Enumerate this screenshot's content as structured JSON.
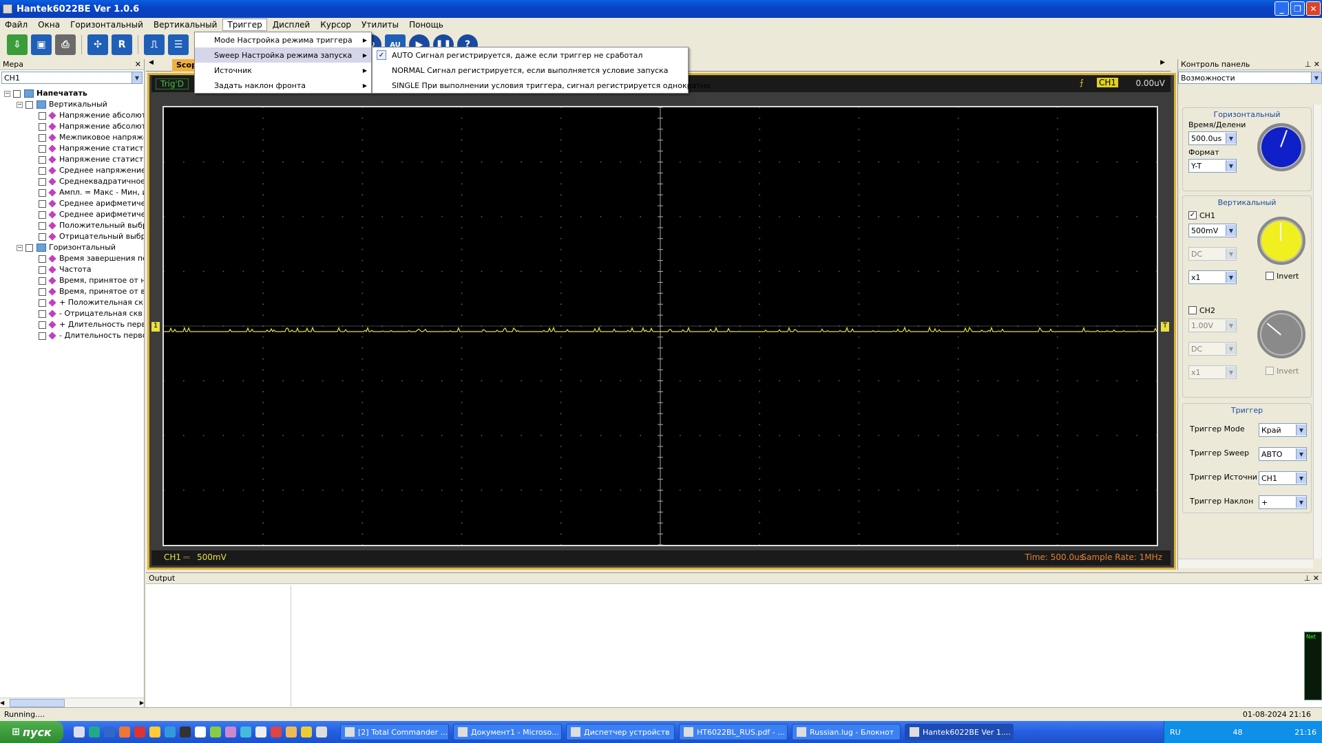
{
  "window": {
    "title": "Hantek6022BE Ver 1.0.6"
  },
  "menubar": [
    "Файл",
    "Окна",
    "Горизонтальный",
    "Вертикальный",
    "Триггер",
    "Дисплей",
    "Курсор",
    "Утилиты",
    "Понощь"
  ],
  "trigger_menu": {
    "items": [
      "Mode Настройка режима триггера",
      "Sweep Настройка режима запуска",
      "Источник",
      "Задать наклон фронта"
    ],
    "highlighted": 1
  },
  "sweep_submenu": {
    "items": [
      "AUTO Сигнал регистрируется, даже если триггер не сработал",
      "NORMAL Сигнал регистрируется, если выполняется условие запуска",
      "SINGLE При выполнении условия триггера, сигнал регистрируется однократно"
    ],
    "checked": 0
  },
  "toolbar": {
    "icons": [
      "open-icon",
      "save-icon",
      "print-icon",
      "autoset-icon",
      "reset-icon",
      "pulse-icon",
      "layout-icon"
    ],
    "r_label": "R",
    "au_label": "AU"
  },
  "left_panel": {
    "title": "Мера",
    "channel": "CH1",
    "tree": {
      "root": "Напечатать",
      "vertical": {
        "label": "Вертикальный",
        "items": [
          "Напряжение абсолюте",
          "Напряжение абсолюте",
          "Межпиковое напряже",
          "Напряжение статисти",
          "Напряжение статисти",
          "Среднее напряжение",
          "Среднеквадратичное",
          "Ампл. = Макс - Мин, и",
          "Среднее арифметичес",
          "Среднее арифметичес",
          "Положительный выбр",
          "Отрицательный выбр"
        ]
      },
      "horizontal": {
        "label": "Горизонтальный",
        "items": [
          "Время завершения пер",
          "Частота",
          "Время, принятое от н",
          "Время, принятое от в",
          "+ Положительная скв",
          "- Отрицательная скв",
          "+ Длительность перв",
          "- Длительность перво"
        ]
      }
    }
  },
  "scope": {
    "tab": "Scop",
    "status": "Trig'D",
    "trigger_channel": "CH1",
    "trigger_level": "0.00uV",
    "ch_label": "CH1",
    "ch_coupling": "⎓",
    "ch_scale": "500mV",
    "time": "Time: 500.0us",
    "sample_rate": "Sample Rate: 1MHz",
    "marker": "1",
    "trace_color": "#e8e040"
  },
  "right_panel": {
    "title": "Контроль панель",
    "combo": "Возможности",
    "horizontal": {
      "title": "Горизонтальный",
      "time_div_label": "Время/Делени",
      "time_div": "500.0us",
      "format_label": "Формат",
      "format": "Y-T",
      "knob_color": "#1020c8"
    },
    "vertical": {
      "title": "Вертикальный",
      "ch1": {
        "label": "CH1",
        "checked": true,
        "volts": "500mV",
        "coupling": "DC",
        "probe": "x1",
        "invert": "Invert",
        "knob_color": "#f0f020"
      },
      "ch2": {
        "label": "CH2",
        "checked": false,
        "volts": "1.00V",
        "coupling": "DC",
        "probe": "x1",
        "invert": "Invert",
        "knob_color": "#8a8a8a"
      }
    },
    "trigger": {
      "title": "Триггер",
      "mode_label": "Триггер Mode",
      "mode": "Край",
      "sweep_label": "Триггер Sweep",
      "sweep": "АВТО",
      "source_label": "Триггер Источни",
      "source": "CH1",
      "slope_label": "Триггер Наклон",
      "slope": "+"
    }
  },
  "output": {
    "title": "Output"
  },
  "status": {
    "left": "Running....",
    "right": "01-08-2024  21:16"
  },
  "taskbar": {
    "start": "пуск",
    "tasks": [
      "[2] Total Commander ...",
      "Документ1 - Microso...",
      "Диспетчер устройств",
      "HT6022BL_RUS.pdf - ...",
      "Russian.lug - Блокнот",
      "Hantek6022BE Ver 1...."
    ],
    "active": 5,
    "lang": "RU",
    "temp": "48",
    "clock": "21:16"
  },
  "net_widget": "Net"
}
